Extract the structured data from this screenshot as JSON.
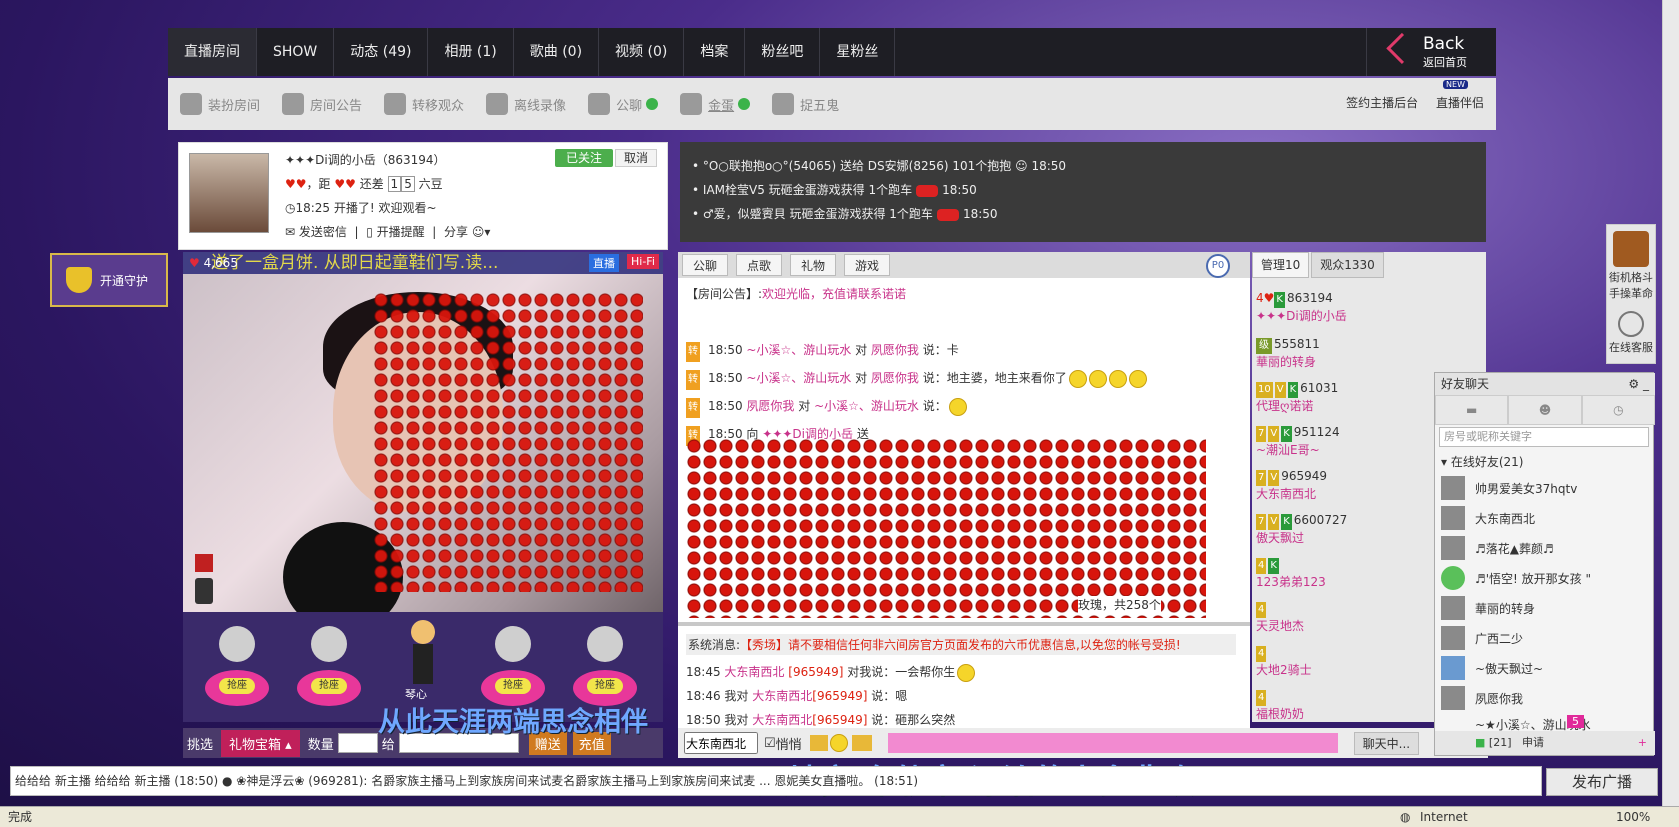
{
  "nav": {
    "tabs": [
      "直播房间",
      "SHOW",
      "动态 (49)",
      "相册 (1)",
      "歌曲 (0)",
      "视频 (0)",
      "档案",
      "粉丝吧",
      "星粉丝"
    ],
    "back_title": "Back",
    "back_sub": "返回首页"
  },
  "toolbar": {
    "items": [
      "装扮房间",
      "房间公告",
      "转移观众",
      "离线录像",
      "公聊",
      "金蛋",
      "捉五鬼"
    ],
    "right1": "签约主播后台",
    "right2": "直播伴侣",
    "new_badge": "NEW"
  },
  "streamer": {
    "name": "✦✦✦Di调的小岳（863194）",
    "line2_a": "，距",
    "line2_b": "还差",
    "line2_num1": "1",
    "line2_num2": "5",
    "line2_c": "六豆",
    "start_line": "18:25 开播了! 欢迎观看~",
    "actions": [
      "发送密信",
      "开播提醒",
      "分享"
    ],
    "followed": "已关注",
    "cancel": "取消"
  },
  "video": {
    "marquee": "送了一盒月饼. 从即日起童鞋们写.读...",
    "viewers": "4,665",
    "live": "直播",
    "hifi": "Hi-Fi"
  },
  "guard_button": "开通守护",
  "seats": [
    "抢座",
    "抢座",
    "抢座",
    "抢座"
  ],
  "seat_center_name": "琴心",
  "lyrics": {
    "line1": "从此天涯两端思念相伴",
    "line2": "天地宽  车轨窄  漂泊的人多悲欢"
  },
  "giftbar": {
    "pick": "挑选",
    "box": "礼物宝箱",
    "qty": "数量",
    "to": "给",
    "send": "赠送",
    "recharge": "充值"
  },
  "giftmsgs": [
    {
      "text": "°O○联抱抱o○°(54065) 送给 DS安娜(8256) 101个抱抱",
      "time": "18:50"
    },
    {
      "text": "IAM栓莹V5 玩砸金蛋游戏获得 1个跑车",
      "time": "18:50"
    },
    {
      "text": "♂爱，似蹙賨貝 玩砸金蛋游戏获得 1个跑车",
      "time": "18:50"
    }
  ],
  "chat": {
    "tabs": [
      "公聊",
      "点歌",
      "礼物",
      "游戏"
    ],
    "p_badge": "P0",
    "notice_label": "【房间公告】:",
    "notice_text": "欢迎光临，充值请联系诺诺",
    "lines": [
      {
        "tag": "转",
        "time": "18:50",
        "from": "~小溪☆、游山玩水",
        "mid": "对",
        "to": "夙愿你我",
        "say": "说：卡"
      },
      {
        "tag": "转",
        "time": "18:50",
        "from": "~小溪☆、游山玩水",
        "mid": "对",
        "to": "夙愿你我",
        "say": "说：地主婆，地主来看你了"
      },
      {
        "tag": "转",
        "time": "18:50",
        "from": "夙愿你我",
        "mid": "对",
        "to": "~小溪☆、游山玩水",
        "say": "说："
      },
      {
        "tag": "转",
        "time": "18:50",
        "from": "",
        "mid": "向",
        "to": "✦✦✦Di调的小岳",
        "say": "送"
      }
    ],
    "rose_summary": "玫瑰，共258个",
    "sys_label": "系统消息:",
    "sys_text": "【秀场】请不要相信任何非六间房官方页面发布的六币优惠信息,以免您的帐号受损!",
    "lines2": [
      {
        "time": "18:45",
        "from": "大东南西北",
        "id": "[965949]",
        "say": "对我说：一会帮你生"
      },
      {
        "time": "18:46",
        "from": "我对",
        "to": "大东南西北",
        "id": "[965949]",
        "say": "说：嗯"
      },
      {
        "time": "18:50",
        "from": "我对",
        "to": "大东南西北",
        "id": "[965949]",
        "say": "说：砸那么突然"
      }
    ]
  },
  "userlist": {
    "tabs": [
      "管理10",
      "观众1330"
    ],
    "rows": [
      {
        "badge": "4",
        "id": "863194",
        "name": "✦✦✦Di调的小岳"
      },
      {
        "badge": "",
        "id": "555811",
        "name": "華丽的转身"
      },
      {
        "badge": "10",
        "id": "61031",
        "name": "代理ღ诺诺"
      },
      {
        "badge": "7",
        "id": "951124",
        "name": "~潮汕E哥~"
      },
      {
        "badge": "7",
        "id": "965949",
        "name": "大东南西北"
      },
      {
        "badge": "7",
        "id": "6600727",
        "name": "傲天飘过"
      },
      {
        "badge": "4",
        "id": "",
        "name": "123弟弟123"
      },
      {
        "badge": "4",
        "id": "",
        "name": "天灵地杰"
      },
      {
        "badge": "4",
        "id": "",
        "name": "大地2骑士"
      },
      {
        "badge": "4",
        "id": "",
        "name": "福根奶奶"
      }
    ]
  },
  "inputrow": {
    "target": "大东南西北",
    "whisper": "悄悄",
    "chat_btn": "聊天中..."
  },
  "friends": {
    "title": "好友聊天",
    "search": "房号或昵称关键字",
    "group": "在线好友(21)",
    "list": [
      "帅男爱美女37hqtv",
      "大东南西北",
      "♬落花▲葬颜♬",
      "♬'悟空! 放开那女孩 \"",
      "華丽的转身",
      "广西二少",
      "~傲天飘过~",
      "夙愿你我",
      "~★小溪☆、游山玩水"
    ],
    "count": "[21]",
    "apply": "申请",
    "badge": "5"
  },
  "sidead": {
    "line1": "街机格斗",
    "line2": "手操革命",
    "service": "在线客服"
  },
  "ticker": "给给给 新主播 给给给 新主播 (18:50) ● ❀神是浮云❀ (969281): 名爵家族主播马上到家族房间来试麦名爵家族主播马上到家族房间来试麦 ... 恩妮美女直播啦。 (18:51)",
  "broadcast": "发布广播",
  "status": {
    "left": "完成",
    "zone": "Internet",
    "zoom": "100%"
  }
}
